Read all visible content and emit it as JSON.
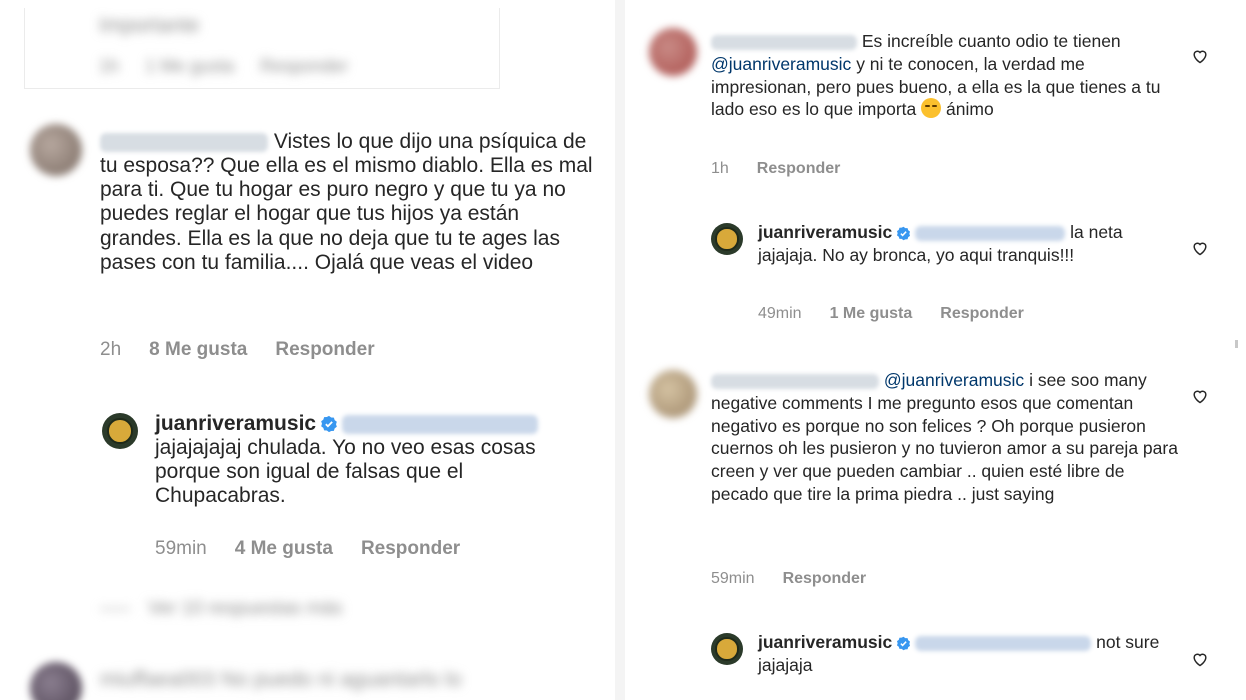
{
  "left": {
    "top_reply": {
      "blur_text": "Importante",
      "blur_likes": "1 Me gusta",
      "blur_reply": "Responder"
    },
    "comment1": {
      "text": "Vistes lo que dijo una psíquica de tu esposa?? Que ella es el mismo diablo. Ella es mal para ti. Que tu hogar es puro negro y que tu ya no puedes reglar el hogar que tus hijos ya están grandes. Ella es la que no deja que tu te ages las pases con tu familia.... Ojalá que veas el video",
      "time": "2h",
      "likes": "8 Me gusta",
      "reply": "Responder"
    },
    "reply1": {
      "username": "juanriveramusic",
      "text": "jajajajajaj chulada. Yo no veo esas cosas porque son igual de falsas que el Chupacabras.",
      "time": "59min",
      "likes": "4 Me gusta",
      "reply": "Responder"
    },
    "view_replies": "Ver 10 respuestas más",
    "bottom_blur": "miuffaea003 No puedo ni aguantarlo lo"
  },
  "right": {
    "comment1": {
      "text": "Es increíble cuanto odio te tienen",
      "mention": "@juanriveramusic",
      "text_after": "y ni te conocen, la verdad me impresionan, pero pues bueno, a ella es la que tienes a tu lado eso es lo que importa",
      "text_end": "ánimo",
      "time": "1h",
      "reply": "Responder"
    },
    "reply1": {
      "username": "juanriveramusic",
      "text": "la neta jajajaja. No ay bronca, yo aqui tranquis!!!",
      "time": "49min",
      "likes": "1 Me gusta",
      "reply": "Responder"
    },
    "comment2": {
      "mention": "@juanriveramusic",
      "text": "i see soo many negative comments I me pregunto esos que comentan negativo es porque no son felices ? Oh porque pusieron cuernos oh les pusieron y no tuvieron amor a su pareja para creen y ver que pueden cambiar .. quien esté libre de pecado que tire la prima piedra .. just saying",
      "time": "59min",
      "reply": "Responder"
    },
    "reply2": {
      "username": "juanriveramusic",
      "text": "not sure jajajaja"
    }
  },
  "colors": {
    "text": "#262626",
    "meta": "#8e8e8e",
    "mention": "#00376b",
    "verified": "#3897f0"
  }
}
